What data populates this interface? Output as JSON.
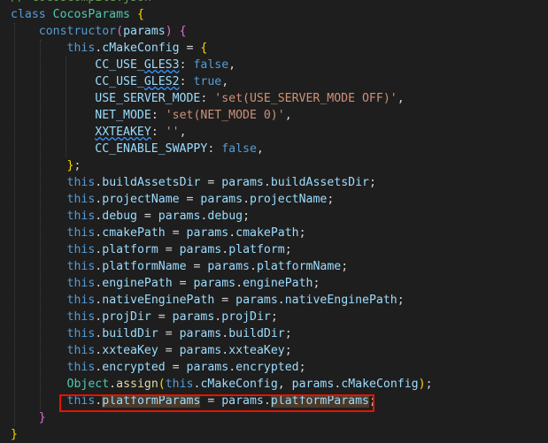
{
  "editor": {
    "lines": [
      {
        "id": "l0",
        "tokens": [
          {
            "t": "// CocosCompile.json",
            "c": "comment"
          }
        ]
      },
      {
        "id": "l1",
        "tokens": [
          {
            "t": "class ",
            "c": "kw"
          },
          {
            "t": "CocosParams",
            "c": "cls"
          },
          {
            "t": " ",
            "c": "punc"
          },
          {
            "t": "{",
            "c": "bracket-y"
          }
        ]
      },
      {
        "id": "l2",
        "tokens": [
          {
            "t": "    "
          },
          {
            "t": "constructor",
            "c": "kw"
          },
          {
            "t": "(",
            "c": "bracket-p"
          },
          {
            "t": "params",
            "c": "prop"
          },
          {
            "t": ")",
            "c": "bracket-p"
          },
          {
            "t": " "
          },
          {
            "t": "{",
            "c": "bracket-p"
          }
        ]
      },
      {
        "id": "l3",
        "tokens": [
          {
            "t": "        "
          },
          {
            "t": "this",
            "c": "kw"
          },
          {
            "t": "."
          },
          {
            "t": "cMakeConfig",
            "c": "prop"
          },
          {
            "t": " = "
          },
          {
            "t": "{",
            "c": "bracket-y"
          }
        ]
      },
      {
        "id": "l4",
        "tokens": [
          {
            "t": "            "
          },
          {
            "t": "CC_USE_",
            "c": "prop"
          },
          {
            "t": "GLES3",
            "c": "prop squig"
          },
          {
            "t": ": "
          },
          {
            "t": "false",
            "c": "kw"
          },
          {
            "t": ","
          }
        ]
      },
      {
        "id": "l5",
        "tokens": [
          {
            "t": "            "
          },
          {
            "t": "CC_USE_",
            "c": "prop"
          },
          {
            "t": "GLES2",
            "c": "prop squig"
          },
          {
            "t": ": "
          },
          {
            "t": "true",
            "c": "kw"
          },
          {
            "t": ","
          }
        ]
      },
      {
        "id": "l6",
        "tokens": [
          {
            "t": "            "
          },
          {
            "t": "USE_SERVER_MODE",
            "c": "prop"
          },
          {
            "t": ": "
          },
          {
            "t": "'set(USE_SERVER_MODE OFF)'",
            "c": "str"
          },
          {
            "t": ","
          }
        ]
      },
      {
        "id": "l7",
        "tokens": [
          {
            "t": "            "
          },
          {
            "t": "NET_MODE",
            "c": "prop"
          },
          {
            "t": ": "
          },
          {
            "t": "'set(NET_MODE 0)'",
            "c": "str"
          },
          {
            "t": ","
          }
        ]
      },
      {
        "id": "l8",
        "tokens": [
          {
            "t": "            "
          },
          {
            "t": "XXTEAKEY",
            "c": "prop squig"
          },
          {
            "t": ": "
          },
          {
            "t": "''",
            "c": "str"
          },
          {
            "t": ","
          }
        ]
      },
      {
        "id": "l9",
        "tokens": [
          {
            "t": "            "
          },
          {
            "t": "CC_ENABLE_SWAPPY",
            "c": "prop"
          },
          {
            "t": ": "
          },
          {
            "t": "false",
            "c": "kw"
          },
          {
            "t": ","
          }
        ]
      },
      {
        "id": "l10",
        "tokens": [
          {
            "t": "        "
          },
          {
            "t": "}",
            "c": "bracket-y"
          },
          {
            "t": ";"
          }
        ]
      },
      {
        "id": "l11",
        "tokens": [
          {
            "t": "        "
          },
          {
            "t": "this",
            "c": "kw"
          },
          {
            "t": "."
          },
          {
            "t": "buildAssetsDir",
            "c": "prop"
          },
          {
            "t": " = "
          },
          {
            "t": "params",
            "c": "prop"
          },
          {
            "t": "."
          },
          {
            "t": "buildAssetsDir",
            "c": "prop"
          },
          {
            "t": ";"
          }
        ]
      },
      {
        "id": "l12",
        "tokens": [
          {
            "t": "        "
          },
          {
            "t": "this",
            "c": "kw"
          },
          {
            "t": "."
          },
          {
            "t": "projectName",
            "c": "prop"
          },
          {
            "t": " = "
          },
          {
            "t": "params",
            "c": "prop"
          },
          {
            "t": "."
          },
          {
            "t": "projectName",
            "c": "prop"
          },
          {
            "t": ";"
          }
        ]
      },
      {
        "id": "l13",
        "tokens": [
          {
            "t": "        "
          },
          {
            "t": "this",
            "c": "kw"
          },
          {
            "t": "."
          },
          {
            "t": "debug",
            "c": "prop"
          },
          {
            "t": " = "
          },
          {
            "t": "params",
            "c": "prop"
          },
          {
            "t": "."
          },
          {
            "t": "debug",
            "c": "prop"
          },
          {
            "t": ";"
          }
        ]
      },
      {
        "id": "l14",
        "tokens": [
          {
            "t": "        "
          },
          {
            "t": "this",
            "c": "kw"
          },
          {
            "t": "."
          },
          {
            "t": "cmakePath",
            "c": "prop"
          },
          {
            "t": " = "
          },
          {
            "t": "params",
            "c": "prop"
          },
          {
            "t": "."
          },
          {
            "t": "cmakePath",
            "c": "prop"
          },
          {
            "t": ";"
          }
        ]
      },
      {
        "id": "l15",
        "tokens": [
          {
            "t": "        "
          },
          {
            "t": "this",
            "c": "kw"
          },
          {
            "t": "."
          },
          {
            "t": "platform",
            "c": "prop"
          },
          {
            "t": " = "
          },
          {
            "t": "params",
            "c": "prop"
          },
          {
            "t": "."
          },
          {
            "t": "platform",
            "c": "prop"
          },
          {
            "t": ";"
          }
        ]
      },
      {
        "id": "l16",
        "tokens": [
          {
            "t": "        "
          },
          {
            "t": "this",
            "c": "kw"
          },
          {
            "t": "."
          },
          {
            "t": "platformName",
            "c": "prop"
          },
          {
            "t": " = "
          },
          {
            "t": "params",
            "c": "prop"
          },
          {
            "t": "."
          },
          {
            "t": "platformName",
            "c": "prop"
          },
          {
            "t": ";"
          }
        ]
      },
      {
        "id": "l17",
        "tokens": [
          {
            "t": "        "
          },
          {
            "t": "this",
            "c": "kw"
          },
          {
            "t": "."
          },
          {
            "t": "enginePath",
            "c": "prop"
          },
          {
            "t": " = "
          },
          {
            "t": "params",
            "c": "prop"
          },
          {
            "t": "."
          },
          {
            "t": "enginePath",
            "c": "prop"
          },
          {
            "t": ";"
          }
        ]
      },
      {
        "id": "l18",
        "tokens": [
          {
            "t": "        "
          },
          {
            "t": "this",
            "c": "kw"
          },
          {
            "t": "."
          },
          {
            "t": "nativeEnginePath",
            "c": "prop"
          },
          {
            "t": " = "
          },
          {
            "t": "params",
            "c": "prop"
          },
          {
            "t": "."
          },
          {
            "t": "nativeEnginePath",
            "c": "prop"
          },
          {
            "t": ";"
          }
        ]
      },
      {
        "id": "l19",
        "tokens": [
          {
            "t": "        "
          },
          {
            "t": "this",
            "c": "kw"
          },
          {
            "t": "."
          },
          {
            "t": "projDir",
            "c": "prop"
          },
          {
            "t": " = "
          },
          {
            "t": "params",
            "c": "prop"
          },
          {
            "t": "."
          },
          {
            "t": "projDir",
            "c": "prop"
          },
          {
            "t": ";"
          }
        ]
      },
      {
        "id": "l20",
        "tokens": [
          {
            "t": "        "
          },
          {
            "t": "this",
            "c": "kw"
          },
          {
            "t": "."
          },
          {
            "t": "buildDir",
            "c": "prop"
          },
          {
            "t": " = "
          },
          {
            "t": "params",
            "c": "prop"
          },
          {
            "t": "."
          },
          {
            "t": "buildDir",
            "c": "prop"
          },
          {
            "t": ";"
          }
        ]
      },
      {
        "id": "l21",
        "tokens": [
          {
            "t": "        "
          },
          {
            "t": "this",
            "c": "kw"
          },
          {
            "t": "."
          },
          {
            "t": "xxteaKey",
            "c": "prop"
          },
          {
            "t": " = "
          },
          {
            "t": "params",
            "c": "prop"
          },
          {
            "t": "."
          },
          {
            "t": "xxteaKey",
            "c": "prop"
          },
          {
            "t": ";"
          }
        ]
      },
      {
        "id": "l22",
        "tokens": [
          {
            "t": "        "
          },
          {
            "t": "this",
            "c": "kw"
          },
          {
            "t": "."
          },
          {
            "t": "encrypted",
            "c": "prop"
          },
          {
            "t": " = "
          },
          {
            "t": "params",
            "c": "prop"
          },
          {
            "t": "."
          },
          {
            "t": "encrypted",
            "c": "prop"
          },
          {
            "t": ";"
          }
        ]
      },
      {
        "id": "l23",
        "tokens": [
          {
            "t": "        "
          },
          {
            "t": "Object",
            "c": "cls"
          },
          {
            "t": "."
          },
          {
            "t": "assign",
            "c": "fn"
          },
          {
            "t": "(",
            "c": "bracket-y"
          },
          {
            "t": "this",
            "c": "kw"
          },
          {
            "t": "."
          },
          {
            "t": "cMakeConfig",
            "c": "prop"
          },
          {
            "t": ", "
          },
          {
            "t": "params",
            "c": "prop"
          },
          {
            "t": "."
          },
          {
            "t": "cMakeConfig",
            "c": "prop"
          },
          {
            "t": ")",
            "c": "bracket-y"
          },
          {
            "t": ";"
          }
        ]
      },
      {
        "id": "l24",
        "tokens": [
          {
            "t": "        "
          },
          {
            "t": "this",
            "c": "kw"
          },
          {
            "t": "."
          },
          {
            "t": "platformParams",
            "c": "prop hl"
          },
          {
            "t": " = "
          },
          {
            "t": "params",
            "c": "prop"
          },
          {
            "t": "."
          },
          {
            "t": "platformParams",
            "c": "prop hl"
          },
          {
            "t": ";"
          }
        ]
      },
      {
        "id": "l25",
        "tokens": [
          {
            "t": "    "
          },
          {
            "t": "}",
            "c": "bracket-p"
          }
        ]
      },
      {
        "id": "l26",
        "tokens": [
          {
            "t": "}",
            "c": "bracket-y"
          }
        ]
      }
    ]
  }
}
